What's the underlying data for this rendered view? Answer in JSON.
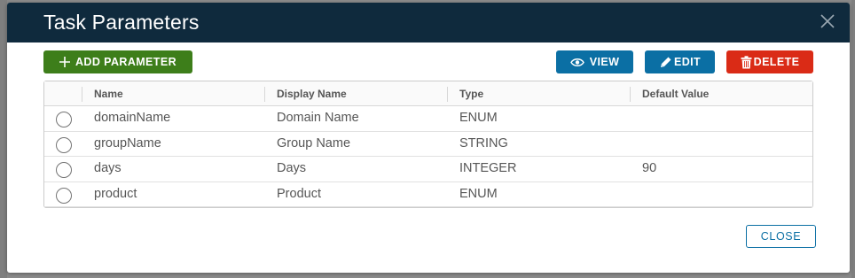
{
  "dialog": {
    "title": "Task Parameters",
    "close_icon": "close-icon"
  },
  "toolbar": {
    "add_label": "ADD PARAMETER",
    "add_icon": "plus-icon",
    "view_label": "VIEW",
    "view_icon": "eye-icon",
    "edit_label": "EDIT",
    "edit_icon": "pencil-icon",
    "delete_label": "DELETE",
    "delete_icon": "trash-icon"
  },
  "table": {
    "columns": [
      "Name",
      "Display Name",
      "Type",
      "Default Value"
    ],
    "rows": [
      {
        "name": "domainName",
        "display_name": "Domain Name",
        "type": "ENUM",
        "default_value": ""
      },
      {
        "name": "groupName",
        "display_name": "Group Name",
        "type": "STRING",
        "default_value": ""
      },
      {
        "name": "days",
        "display_name": "Days",
        "type": "INTEGER",
        "default_value": "90"
      },
      {
        "name": "product",
        "display_name": "Product",
        "type": "ENUM",
        "default_value": ""
      }
    ]
  },
  "footer": {
    "close_label": "CLOSE"
  },
  "colors": {
    "header_bg": "#0f2a3d",
    "add_button": "#3d7e1a",
    "action_button": "#0b6fa4",
    "delete_button": "#da2b16"
  }
}
